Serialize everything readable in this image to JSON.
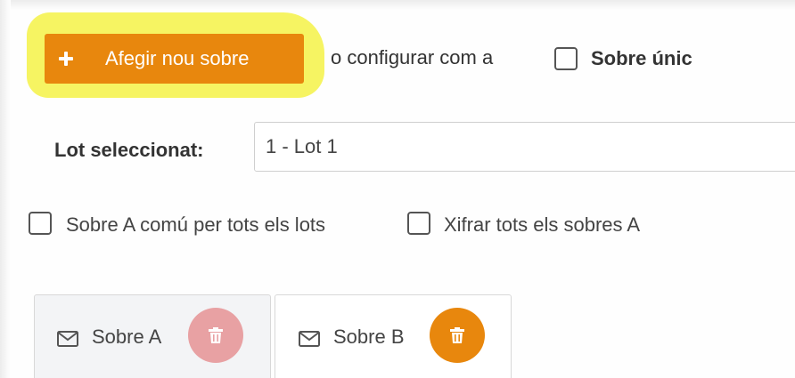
{
  "toolbar": {
    "add_label": "Afegir nou sobre",
    "add_icon": "plus-icon",
    "or_text": "o configurar com a",
    "single_label": "Sobre únic",
    "single_checked": false
  },
  "lot": {
    "label": "Lot seleccionat:",
    "selected": "1 - Lot 1"
  },
  "options": {
    "common_label": "Sobre A comú per tots els lots",
    "common_checked": false,
    "encrypt_label": "Xifrar tots els sobres A",
    "encrypt_checked": false
  },
  "tabs": [
    {
      "label": "Sobre A",
      "icon": "envelope-icon",
      "delete_icon": "trash-icon",
      "active": false
    },
    {
      "label": "Sobre B",
      "icon": "envelope-icon",
      "delete_icon": "trash-icon",
      "active": true
    }
  ],
  "colors": {
    "accent": "#e8870d",
    "delete_disabled": "#e8a1a3",
    "highlight": "#f6f35a"
  }
}
